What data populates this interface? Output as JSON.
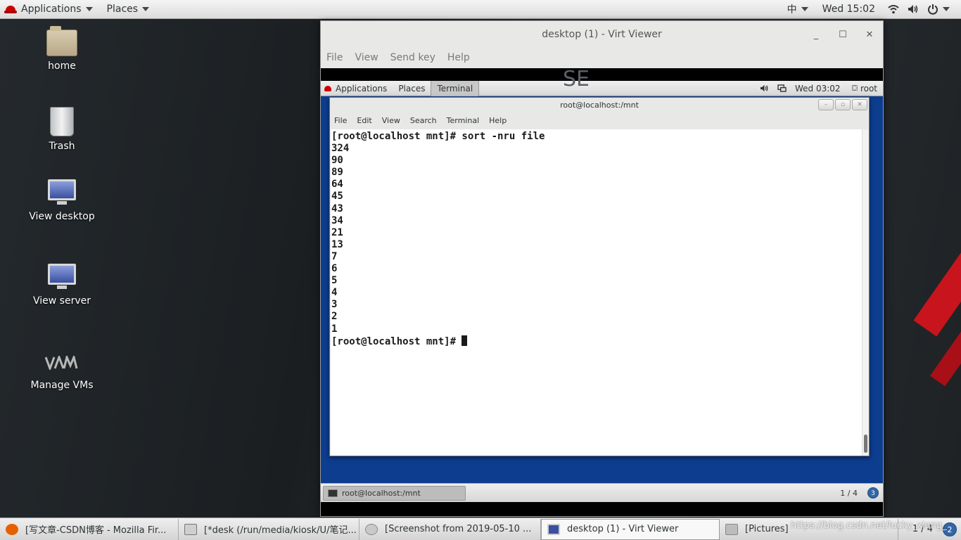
{
  "top_panel": {
    "applications": "Applications",
    "places": "Places",
    "input_method": "中",
    "clock": "Wed 15:02"
  },
  "desktop_icons": [
    {
      "label": "home",
      "icon": "home-folder-icon"
    },
    {
      "label": "Trash",
      "icon": "trash-icon"
    },
    {
      "label": "View desktop",
      "icon": "monitor-icon"
    },
    {
      "label": "View server",
      "icon": "monitor-icon"
    },
    {
      "label": "Manage VMs",
      "icon": "vm-logo-icon"
    }
  ],
  "virt_viewer": {
    "title": "desktop (1) - Virt Viewer",
    "menu": [
      "File",
      "View",
      "Send key",
      "Help"
    ]
  },
  "guest": {
    "top_panel": {
      "applications": "Applications",
      "places": "Places",
      "terminal_tab": "Terminal",
      "clock": "Wed 03:02",
      "user": "root"
    },
    "background_logo": "SE",
    "terminal": {
      "title": "root@localhost:/mnt",
      "menu": [
        "File",
        "Edit",
        "View",
        "Search",
        "Terminal",
        "Help"
      ],
      "lines": [
        "[root@localhost mnt]# sort -nru file",
        "324",
        "90",
        "89",
        "64",
        "45",
        "43",
        "34",
        "21",
        "13",
        "7",
        "6",
        "5",
        "4",
        "3",
        "2",
        "1"
      ],
      "prompt": "[root@localhost mnt]# "
    },
    "bottom_panel": {
      "task": "root@localhost:/mnt",
      "pager": "1 / 4",
      "badge": "3"
    }
  },
  "taskbar": {
    "items": [
      {
        "label": "[写文章-CSDN博客 - Mozilla Fir...",
        "icon": "firefox-icon",
        "color": "#e66000"
      },
      {
        "label": "[*desk (/run/media/kiosk/U/笔记...",
        "icon": "text-editor-icon",
        "color": "#8f8f8f"
      },
      {
        "label": "[Screenshot from 2019-05-10 ...",
        "icon": "image-viewer-icon",
        "color": "#9a9a9a"
      },
      {
        "label": "desktop (1) - Virt Viewer",
        "icon": "virt-viewer-icon",
        "color": "#3a4fa0"
      },
      {
        "label": "[Pictures]",
        "icon": "file-manager-icon",
        "color": "#a0a0a0"
      }
    ],
    "pager": "1 / 4",
    "badge": "2"
  },
  "watermark": "https://blog.csdn.net/lucky_xiang_"
}
